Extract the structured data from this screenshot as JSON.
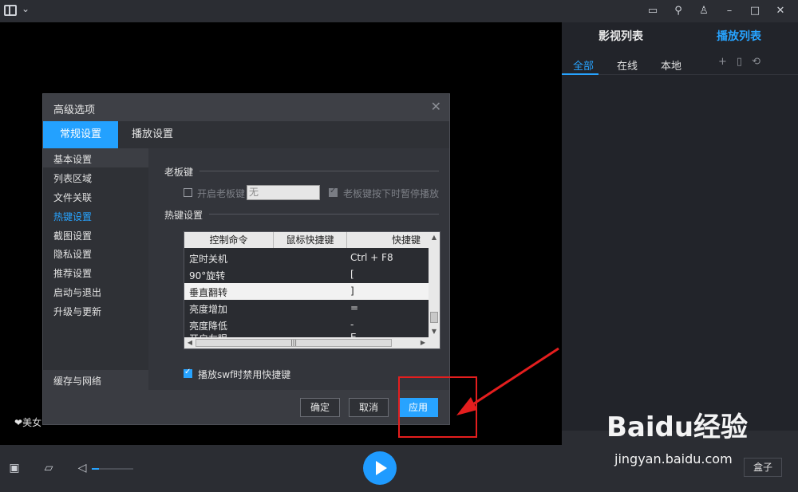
{
  "topbar": {
    "icons": [
      "layout-icon",
      "feedback-icon",
      "pin-icon",
      "skin-icon",
      "minimize-icon",
      "maximize-icon",
      "close-icon"
    ]
  },
  "video": {
    "overlay_text": "美女"
  },
  "playlist_panel": {
    "tabs": [
      {
        "label": "影视列表",
        "active": false
      },
      {
        "label": "播放列表",
        "active": true
      }
    ],
    "subtabs": [
      {
        "label": "全部",
        "active": true
      },
      {
        "label": "在线",
        "active": false
      },
      {
        "label": "本地",
        "active": false
      }
    ]
  },
  "dialog": {
    "title": "高级选项",
    "tabs": [
      {
        "label": "常规设置",
        "active": true
      },
      {
        "label": "播放设置",
        "active": false
      }
    ],
    "sidebar": {
      "items": [
        {
          "label": "基本设置"
        },
        {
          "label": "列表区域"
        },
        {
          "label": "文件关联"
        },
        {
          "label": "热键设置",
          "active": true
        },
        {
          "label": "截图设置"
        },
        {
          "label": "隐私设置"
        },
        {
          "label": "推荐设置"
        },
        {
          "label": "启动与退出"
        },
        {
          "label": "升级与更新"
        }
      ],
      "footer": "缓存与网络"
    },
    "boss_key": {
      "section_title": "老板键",
      "enable_label": "开启老板键",
      "enable_checked": false,
      "key_value": "无",
      "pause_label": "老板键按下时暂停播放",
      "pause_checked": true
    },
    "hotkeys": {
      "section_title": "热键设置",
      "columns": [
        "控制命令",
        "鼠标快捷键",
        "快捷键"
      ],
      "rows": [
        {
          "command": "定时关机",
          "mouse": "",
          "key": "Ctrl + F8"
        },
        {
          "command": "90°旋转",
          "mouse": "",
          "key": "["
        },
        {
          "command": "垂直翻转",
          "mouse": "",
          "key": "]",
          "selected": true
        },
        {
          "command": "亮度增加",
          "mouse": "",
          "key": "="
        },
        {
          "command": "亮度降低",
          "mouse": "",
          "key": "-"
        },
        {
          "command": "开启左眼",
          "mouse": "",
          "key": "E"
        }
      ],
      "swf_label": "播放swf时禁用快捷键",
      "swf_checked": true
    },
    "buttons": {
      "ok": "确定",
      "cancel": "取消",
      "apply": "应用"
    }
  },
  "bottombar": {
    "volume_level": 0.18,
    "box_label": "盒子"
  },
  "watermark": {
    "brand": "Baidu经验",
    "url": "jingyan.baidu.com"
  },
  "colors": {
    "accent": "#27a3ff",
    "annotation": "#e41e1e"
  }
}
